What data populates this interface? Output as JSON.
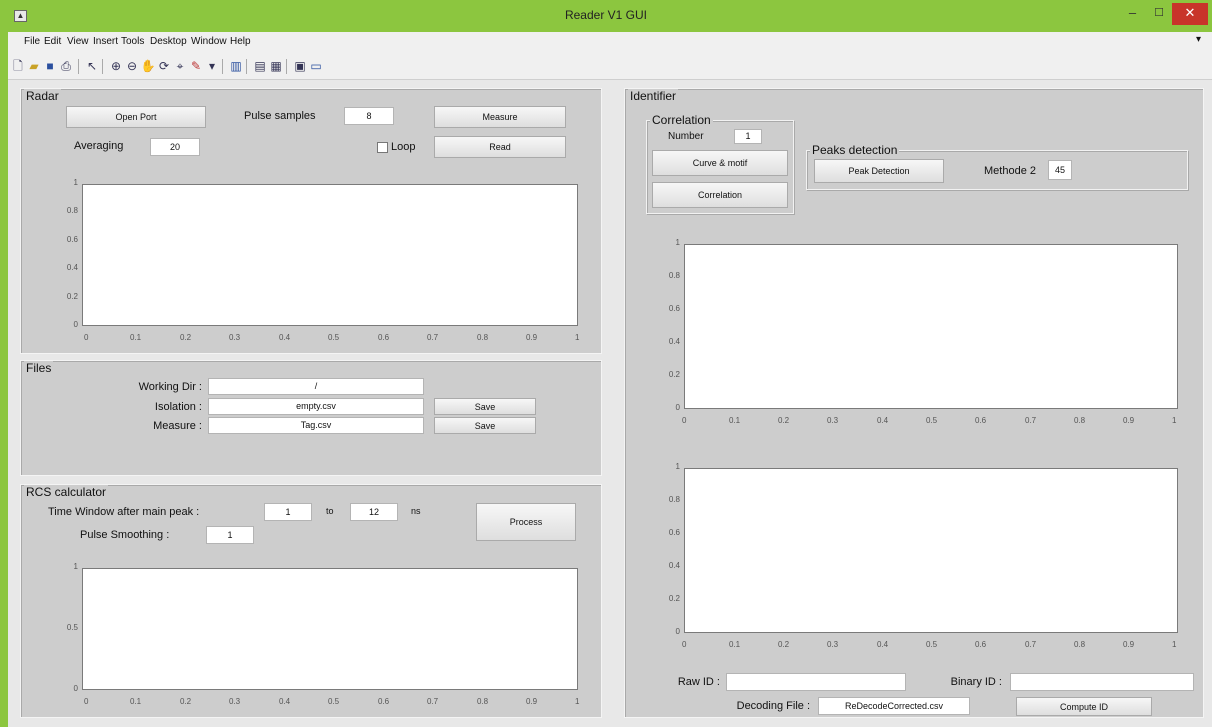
{
  "window": {
    "title": "Reader V1 GUI",
    "minimize": "–",
    "maximize": "☐",
    "close": "✕"
  },
  "menubar": [
    "File",
    "Edit",
    "View",
    "Insert",
    "Tools",
    "Desktop",
    "Window",
    "Help"
  ],
  "toolbar_icons": [
    "new-file-icon",
    "open-folder-icon",
    "save-icon",
    "print-icon",
    "pointer-icon",
    "zoom-in-icon",
    "zoom-out-icon",
    "pan-icon",
    "rotate-3d-icon",
    "data-cursor-icon",
    "brush-icon",
    "link-icon",
    "colorbar-icon",
    "legend-icon",
    "hide-plot-tools-icon",
    "show-plot-tools-icon"
  ],
  "radar": {
    "title": "Radar",
    "open_port": "Open Port",
    "pulse_samples_label": "Pulse samples",
    "pulse_samples_value": "8",
    "measure": "Measure",
    "averaging_label": "Averaging",
    "averaging_value": "20",
    "loop_label": "Loop",
    "loop_checked": false,
    "read": "Read",
    "axis_y": [
      "0",
      "0.2",
      "0.4",
      "0.6",
      "0.8",
      "1"
    ],
    "axis_x": [
      "0",
      "0.1",
      "0.2",
      "0.3",
      "0.4",
      "0.5",
      "0.6",
      "0.7",
      "0.8",
      "0.9",
      "1"
    ]
  },
  "files": {
    "title": "Files",
    "working_dir_label": "Working Dir :",
    "working_dir_value": "/",
    "isolation_label": "Isolation :",
    "isolation_value": "empty.csv",
    "isolation_save": "Save",
    "measure_label": "Measure :",
    "measure_value": "Tag.csv",
    "measure_save": "Save"
  },
  "rcs": {
    "title": "RCS calculator",
    "time_window_label": "Time Window after main peak :",
    "time_from": "1",
    "to_label": "to",
    "time_to": "12",
    "unit": "ns",
    "smoothing_label": "Pulse Smoothing :",
    "smoothing_value": "1",
    "process": "Process",
    "axis_y": [
      "0",
      "0.5",
      "1"
    ],
    "axis_x": [
      "0",
      "0.1",
      "0.2",
      "0.3",
      "0.4",
      "0.5",
      "0.6",
      "0.7",
      "0.8",
      "0.9",
      "1"
    ]
  },
  "identifier": {
    "title": "Identifier",
    "correlation_title": "Correlation",
    "number_label": "Number",
    "number_value": "1",
    "curve_motif": "Curve & motif",
    "correlation_btn": "Correlation",
    "peaks_title": "Peaks detection",
    "peak_detection": "Peak Detection",
    "method_label": "Methode 2",
    "method_value": "45",
    "axis_y": [
      "0",
      "0.2",
      "0.4",
      "0.6",
      "0.8",
      "1"
    ],
    "axis_x": [
      "0",
      "0.1",
      "0.2",
      "0.3",
      "0.4",
      "0.5",
      "0.6",
      "0.7",
      "0.8",
      "0.9",
      "1"
    ],
    "raw_id_label": "Raw ID :",
    "raw_id_value": "",
    "binary_id_label": "Binary ID :",
    "binary_id_value": "",
    "decoding_file_label": "Decoding File :",
    "decoding_file_value": "ReDecodeCorrected.csv",
    "compute_id": "Compute ID"
  }
}
